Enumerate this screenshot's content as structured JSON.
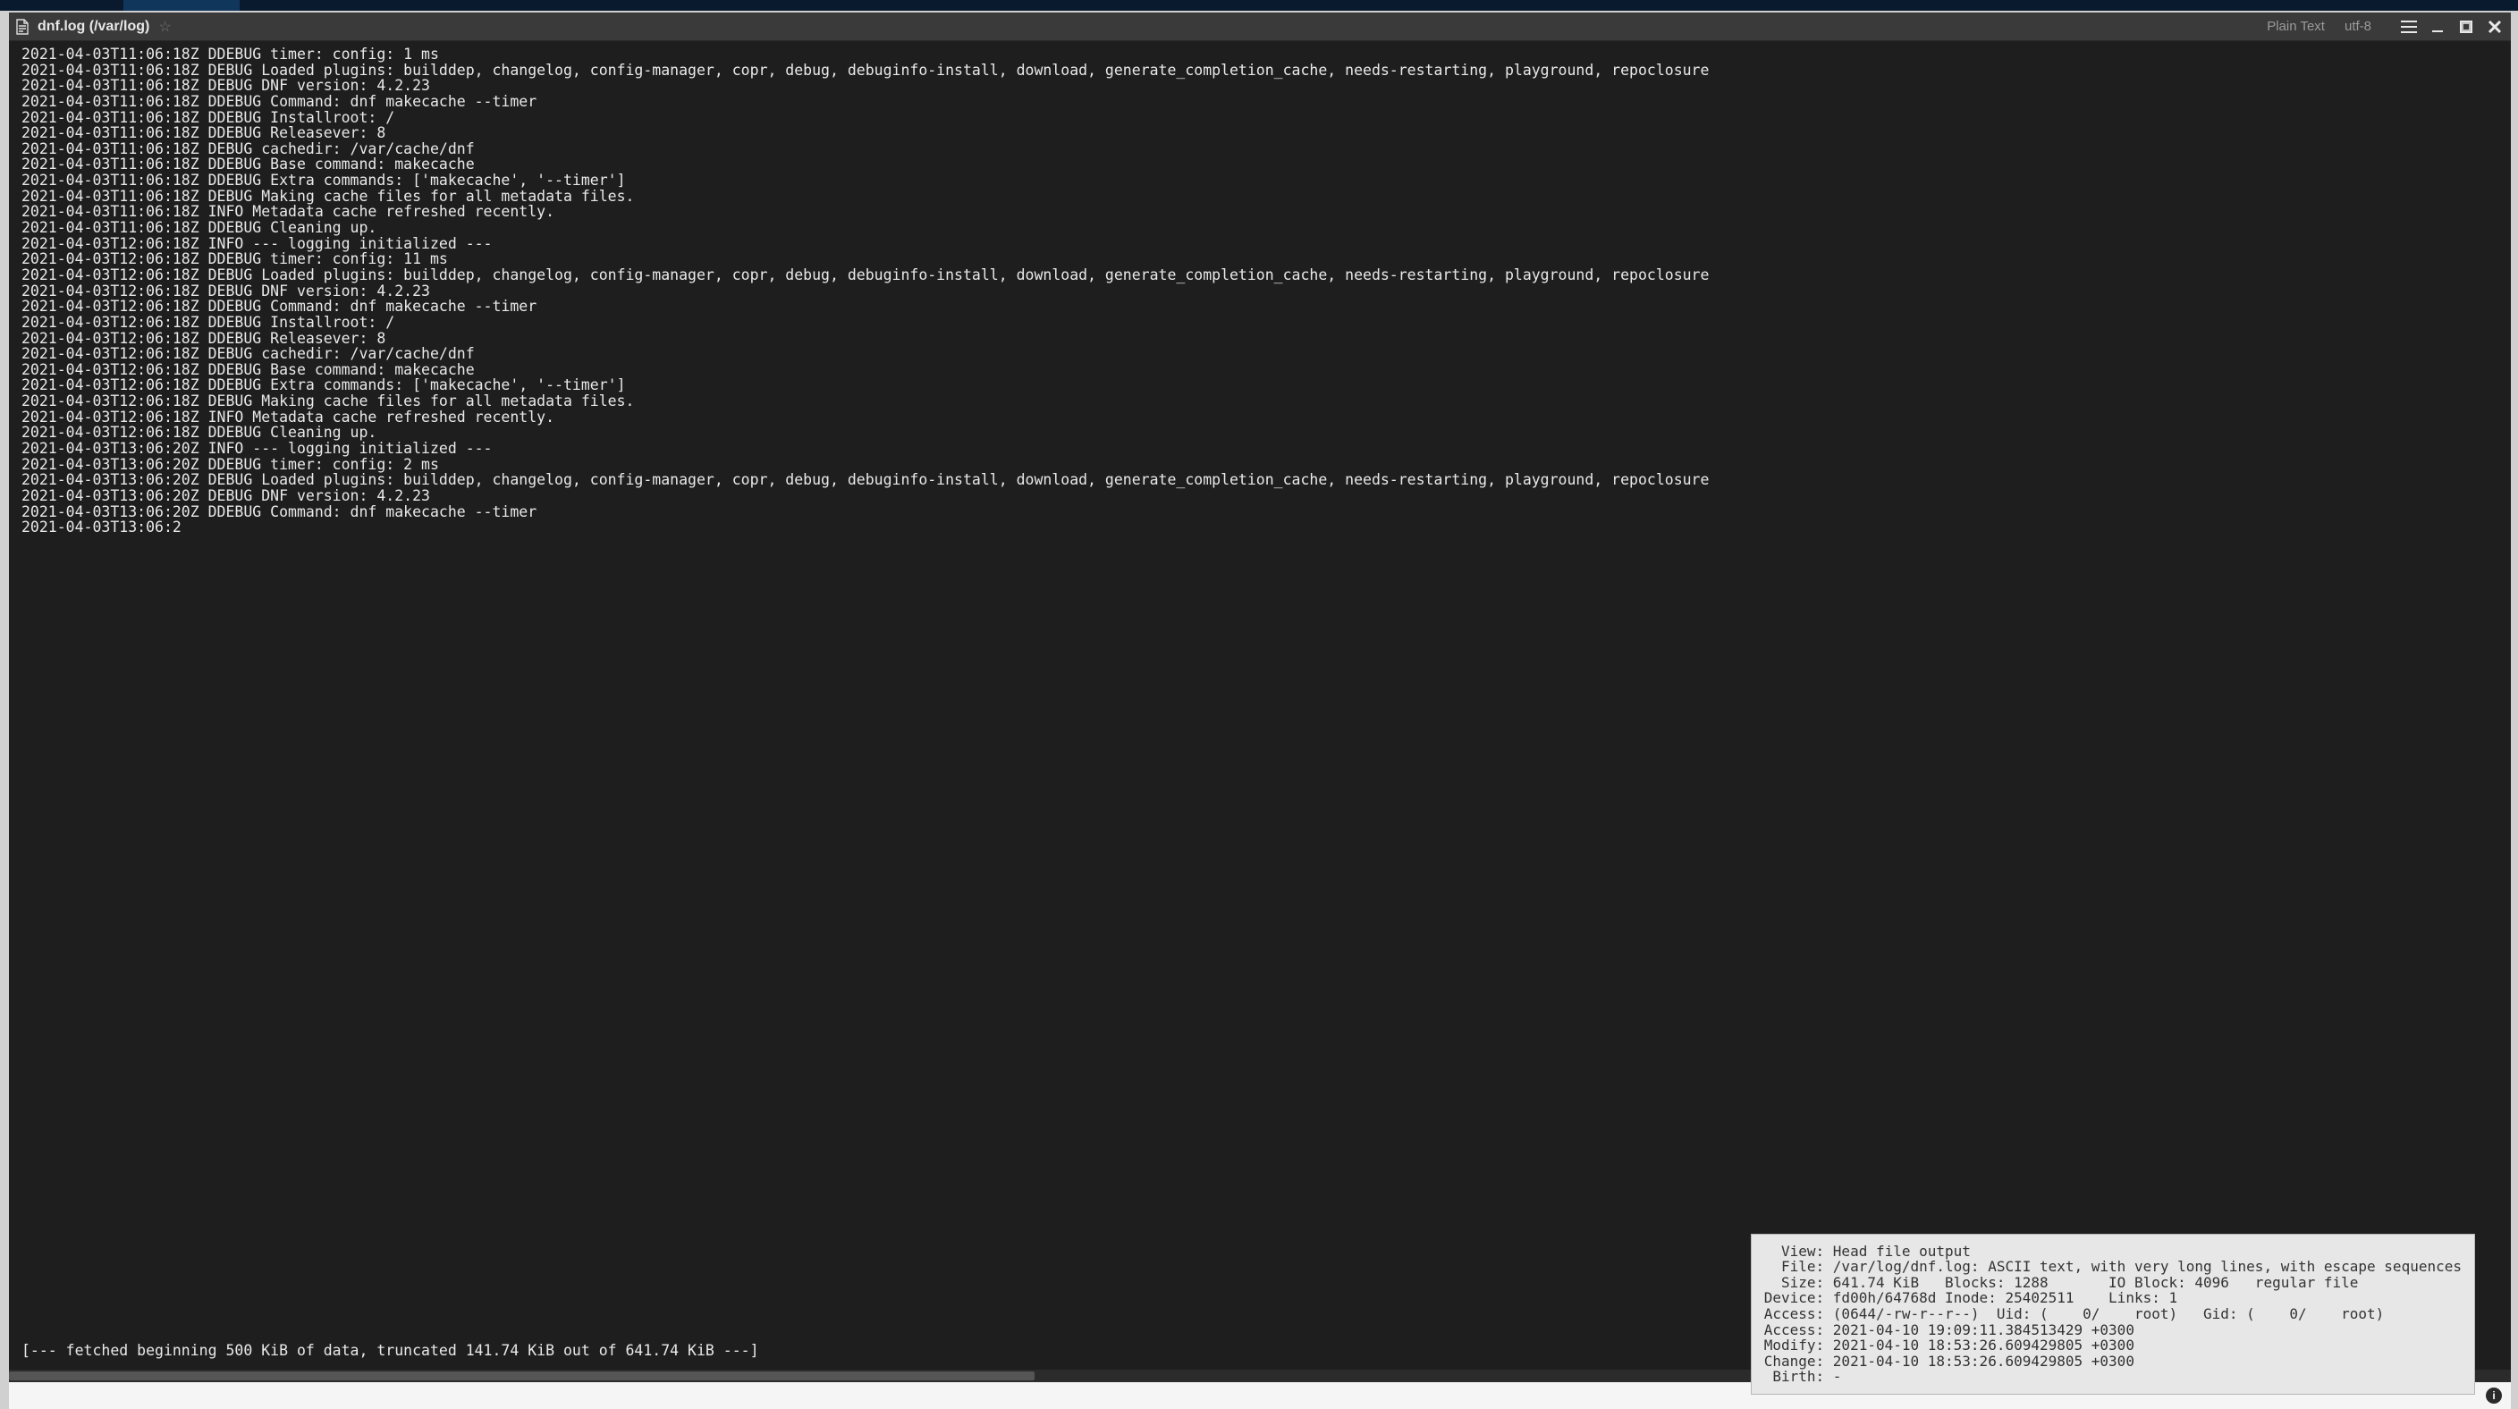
{
  "titlebar": {
    "tab_title": "dnf.log (/var/log)",
    "mode": "Plain Text",
    "encoding": "utf-8"
  },
  "log_lines": [
    "2021-04-03T11:06:18Z DDEBUG timer: config: 1 ms",
    "2021-04-03T11:06:18Z DEBUG Loaded plugins: builddep, changelog, config-manager, copr, debug, debuginfo-install, download, generate_completion_cache, needs-restarting, playground, repoclosure",
    "2021-04-03T11:06:18Z DEBUG DNF version: 4.2.23",
    "2021-04-03T11:06:18Z DDEBUG Command: dnf makecache --timer",
    "2021-04-03T11:06:18Z DDEBUG Installroot: /",
    "2021-04-03T11:06:18Z DDEBUG Releasever: 8",
    "2021-04-03T11:06:18Z DEBUG cachedir: /var/cache/dnf",
    "2021-04-03T11:06:18Z DDEBUG Base command: makecache",
    "2021-04-03T11:06:18Z DDEBUG Extra commands: ['makecache', '--timer']",
    "2021-04-03T11:06:18Z DEBUG Making cache files for all metadata files.",
    "2021-04-03T11:06:18Z INFO Metadata cache refreshed recently.",
    "2021-04-03T11:06:18Z DDEBUG Cleaning up.",
    "2021-04-03T12:06:18Z INFO --- logging initialized ---",
    "2021-04-03T12:06:18Z DDEBUG timer: config: 11 ms",
    "2021-04-03T12:06:18Z DEBUG Loaded plugins: builddep, changelog, config-manager, copr, debug, debuginfo-install, download, generate_completion_cache, needs-restarting, playground, repoclosure",
    "2021-04-03T12:06:18Z DEBUG DNF version: 4.2.23",
    "2021-04-03T12:06:18Z DDEBUG Command: dnf makecache --timer",
    "2021-04-03T12:06:18Z DDEBUG Installroot: /",
    "2021-04-03T12:06:18Z DDEBUG Releasever: 8",
    "2021-04-03T12:06:18Z DEBUG cachedir: /var/cache/dnf",
    "2021-04-03T12:06:18Z DDEBUG Base command: makecache",
    "2021-04-03T12:06:18Z DDEBUG Extra commands: ['makecache', '--timer']",
    "2021-04-03T12:06:18Z DEBUG Making cache files for all metadata files.",
    "2021-04-03T12:06:18Z INFO Metadata cache refreshed recently.",
    "2021-04-03T12:06:18Z DDEBUG Cleaning up.",
    "2021-04-03T13:06:20Z INFO --- logging initialized ---",
    "2021-04-03T13:06:20Z DDEBUG timer: config: 2 ms",
    "2021-04-03T13:06:20Z DEBUG Loaded plugins: builddep, changelog, config-manager, copr, debug, debuginfo-install, download, generate_completion_cache, needs-restarting, playground, repoclosure",
    "2021-04-03T13:06:20Z DEBUG DNF version: 4.2.23",
    "2021-04-03T13:06:20Z DDEBUG Command: dnf makecache --timer",
    "2021-04-03T13:06:2"
  ],
  "truncate_note": "[--- fetched beginning 500 KiB of data, truncated 141.74 KiB out of 641.74 KiB ---]",
  "tooltip_lines": [
    "  View: Head file output",
    "  File: /var/log/dnf.log: ASCII text, with very long lines, with escape sequences",
    "  Size: 641.74 KiB   Blocks: 1288       IO Block: 4096   regular file",
    "Device: fd00h/64768d Inode: 25402511    Links: 1",
    "Access: (0644/-rw-r--r--)  Uid: (    0/    root)   Gid: (    0/    root)",
    "Access: 2021-04-10 19:09:11.384513429 +0300",
    "Modify: 2021-04-10 18:53:26.609429805 +0300",
    "Change: 2021-04-10 18:53:26.609429805 +0300",
    " Birth: -"
  ],
  "statusbar": {
    "hint": ""
  }
}
